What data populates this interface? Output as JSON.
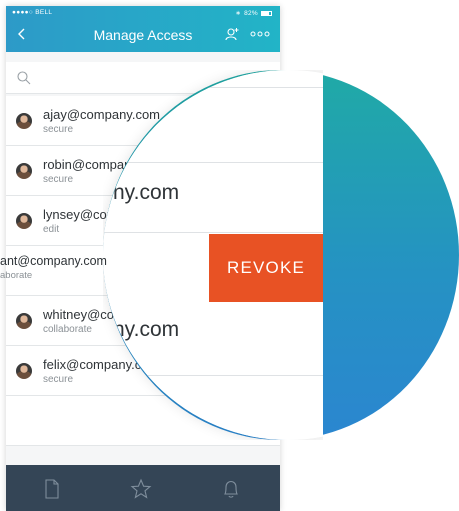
{
  "status_bar": {
    "carrier": "●●●●○ BELL",
    "battery": "82%"
  },
  "nav": {
    "title": "Manage Access"
  },
  "users": [
    {
      "email": "ajay@company.com",
      "permission": "secure"
    },
    {
      "email": "robin@company.com",
      "permission": "secure"
    },
    {
      "email": "lynsey@company.com",
      "permission": "edit"
    },
    {
      "email": "grant@company.com",
      "permission": "collaborate"
    },
    {
      "email": "whitney@company.com",
      "permission": "collaborate"
    },
    {
      "email": "felix@company.com",
      "permission": "secure"
    }
  ],
  "magnified": {
    "robin_fragment": "ny.com",
    "grant_email_fragment": "ant@company.com",
    "grant_perm_fragment": "aborate",
    "whitney_fragment": "ny.com",
    "revoke_label": "REVOKE"
  },
  "colors": {
    "accent": "#e85224",
    "nav_start": "#2d9ac8",
    "nav_end": "#22b4c7",
    "tabbar": "#344556"
  }
}
